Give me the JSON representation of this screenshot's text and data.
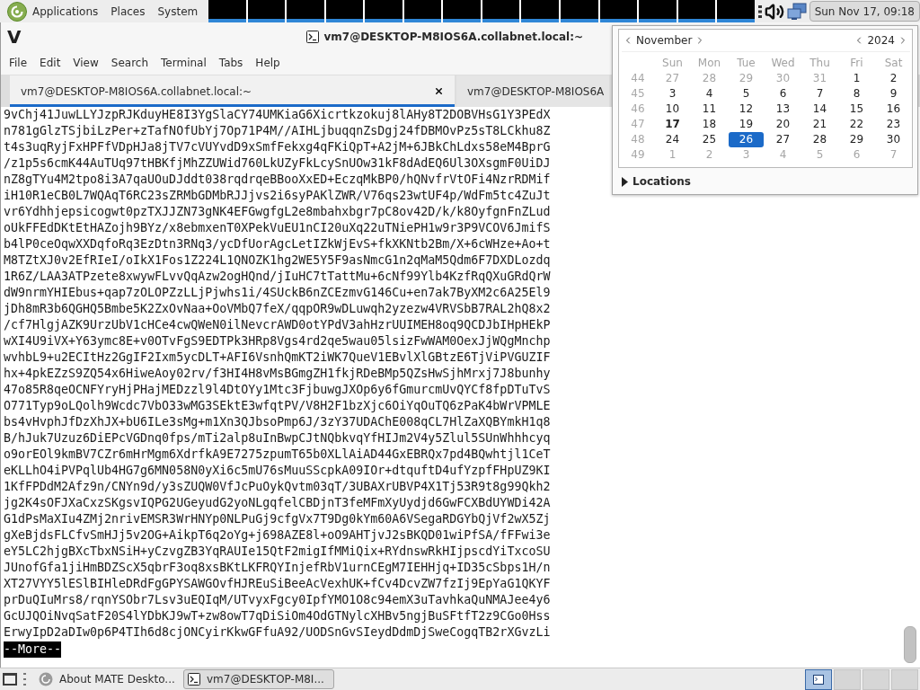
{
  "top_panel": {
    "menus": [
      "Applications",
      "Places",
      "System"
    ],
    "clock": {
      "label": "Sun Nov 17, 09:18",
      "active": true
    }
  },
  "window": {
    "logo": "V",
    "title": "vm7@DESKTOP-M8IOS6A.collabnet.local:~"
  },
  "menu_bar": [
    "File",
    "Edit",
    "View",
    "Search",
    "Terminal",
    "Tabs",
    "Help"
  ],
  "tabs": [
    {
      "label": "vm7@DESKTOP-M8IOS6A.collabnet.local:~",
      "selected": true
    },
    {
      "label": "vm7@DESKTOP-M8IOS6A",
      "selected": false
    }
  ],
  "terminal": {
    "lines": [
      "9vChj41JuwLLYJzpRJKduyHE8I3YgSlaCY74UMKiaG6Xicrtkzokuj8lAHy8T2DOBVHsG1Y3PEdX",
      "n781gGlzTSjbiLzPer+zTafNOfUbYj7Op71P4M//AIHLjbuqqnZsDgj24fDBMOvPz5sT8LCkhu8Z",
      "t4s3uqRyjFxHPFfVDpHJa8jTV7cVUYvdD9xSmfFekxg4qFKiQpT+A2jM+6JBkChLdxs58eM4BprG",
      "/z1p5s6cmK44AuTUq97tHBKfjMhZZUWid760LkUZyFkLcySnUOw31kF8dAdEQ6Ul3OXsgmF0UiDJ",
      "nZ8gTYu4M2tpo8i3A7qaUOuDJddt038rqdrqeBBooXxED+EczqMkBP0/hQNvfrVtOFi4NzrRDMif",
      "iH10R1eCB0L7WQAqT6RC23sZRMbGDMbRJJjvs2i6syPAKlZWR/V76qs23wtUF4p/WdFm5tc4ZuJt",
      "vr6Ydhhjepsicogwt0pzTXJJZN73gNK4EFGwgfgL2e8mbahxbgr7pC8ov42D/k/k8OyfgnFnZLud",
      "oUkFFEdDKtEtHAZojh9BYz/x8ebmxenT0XPekVuEU1nCI20uXq22uTNiePH1w9r3P9VCOV6JmifS",
      "b4lP0ceOqwXXDqfoRq3EzDtn3RNq3/ycDfUorAgcLetIZkWjEvS+fkXKNtb2Bm/X+6cWHze+Ao+t",
      "M8TZtXJ0v2EfRIeI/oIkX1Fos1Z224L1QNOZK1hg2WE5Y5F9asNmcG1n2qMaM5Qdm6F7DXDLozdq",
      "1R6Z/LAA3ATPzete8xwywFLvvQqAzw2ogHQnd/jIuHC7tTattMu+6cNf99Ylb4KzfRqQXuGRdQrW",
      "dW9nrmYHIEbus+qap7zOLOPZzLLjPjwhs1i/4SUckB6nZCEzmvG146Cu+en7ak7ByXM2c6A25El9",
      "jDh8mR3b6QGHQ5Bmbe5K2ZxOvNaa+OoVMbQ7feX/qqpOR9wDLuwqh2yzezw4VRVSbB7RAL2hQ8x2",
      "/cf7HlgjAZK9UrzUbV1cHCe4cwQWeN0ilNevcrAWD0otYPdV3ahHzrUUIMEH8oq9QCDJbIHpHEkP",
      "wXI4U9iVX+Y63ymc8E+v0OTvFgS9EDTPk3HRp8Vgs4rd2qe5wau05lsizFwWAM0OexJjWQgMnchp",
      "wvhbL9+u2ECItHz2GgIF2Ixm5ycDLT+AFI6VsnhQmKT2iWK7QueV1EBvlXlGBtzE6TjViPVGUZIF",
      "hx+4pkEZzS9ZQ54x6HiweAoy02rv/f3HI4H8vMsBGmgZH1fkjRDeBMp5QZsHwSjhMrxj7J8bunhy",
      "47o85R8qeOCNFYryHjPHajMEDzzl9l4DtOYy1Mtc3FjbuwgJXOp6y6fGmurcmUvQYCf8fpDTuTvS",
      "O771Typ9oLQolh9Wcdc7VbO33wMG3SEktE3wfqtPV/V8H2F1bzXjc6OiYqOuTQ6zPaK4bWrVPMLE",
      "bs4vHvphJfDzXhJX+bU6ILe3sMg+m1Xn3QJbsoPmp6J/3zY37UDAChE008qCL7HlZaXQBYmkH1q8",
      "B/hJuk7Uzuz6DiEPcVGDnq0fps/mTi2alp8uInBwpCJtNQbkvqYfHIJm2V4y5Zlul5SUnWhhhcyq",
      "o9orEOl9kmBV7CZr6mHrMgm6XdrfkA9E7275zpumT65b0XLlAiAD44GxEBRQx7pd4BQwhtjl1CeT",
      "eKLLhO4iPVPqlUb4HG7g6MN058N0yXi6c5mU76sMuuSScpkA09IOr+dtquftD4ufYzpfFHpUZ9KI",
      "1KfFPDdM2Afz9n/CNYn9d/y3sZUQW0VfJcPuOykQvtm03qT/3UBAXrUBVP4X1Tj53R9t8g99Qkh2",
      "jg2K4sOFJXaCxzSKgsvIQPG2UGeyudG2yoNLgqfelCBDjnT3feMFmXyUydjd6GwFCXBdUYWDi42A",
      "G1dPsMaXIu4ZMj2nrivEMSR3WrHNYp0NLPuGj9cfgVx7T9Dg0kYm60A6VSegaRDGYbQjVf2wX5Zj",
      "gXeBjdsFLCfvSmHJj5v2OG+AikpT6q2oYg+j698AZE8l+oO9AHTjvJ2sBKQD01wiPfSA/fFFwi3e",
      "eY5LC2hjgBXcTbxNSiH+yCzvgZB3YqRAUIe15QtF2migIfMMiQix+RYdnswRkHIjpscdYiTxcoSU",
      "JUnofGfa1jiHmBDZScX5qbrF3oq8xsBKtLKFRQYInjefRbV1urnCEgM7IEHHjq+ID35cSbps1H/n",
      "XT27VYY5lESlBIHleDRdFgGPYSAWGOvfHJREuSiBeeAcVexhUK+fCv4DcvZW7fzIj9EpYaG1QKYF",
      "prDuQIuMrs8/rqnYSObr7Lsv3uEQIqM/UTvyxFgcy0IpfYMO1O8c94emX3uTavhkaQuNMAJee4y6",
      "GcUJQOiNvqSatF20S4lYDbKJ9wT+zw8owT7qDiSiOm4OdGTNylcXHBv5ngjBuSFtfT2z9CGo0Hss",
      "ErwyIpD2aDIw0p6P4TIh6d8cjONCyirKkwGFfuA92/UODSnGvSIeydDdmDjSweCogqTB2rXGvzLi"
    ],
    "pager_prompt": "--More--"
  },
  "calendar": {
    "month": "November",
    "year": "2024",
    "weekdays": [
      "Sun",
      "Mon",
      "Tue",
      "Wed",
      "Thu",
      "Fri",
      "Sat"
    ],
    "weeks": [
      {
        "number": "44",
        "days": [
          {
            "label": "27",
            "outside": true,
            "today": false,
            "selected": false
          },
          {
            "label": "28",
            "outside": true,
            "today": false,
            "selected": false
          },
          {
            "label": "29",
            "outside": true,
            "today": false,
            "selected": false
          },
          {
            "label": "30",
            "outside": true,
            "today": false,
            "selected": false
          },
          {
            "label": "31",
            "outside": true,
            "today": false,
            "selected": false
          },
          {
            "label": "1",
            "outside": false,
            "today": false,
            "selected": false
          },
          {
            "label": "2",
            "outside": false,
            "today": false,
            "selected": false
          }
        ]
      },
      {
        "number": "45",
        "days": [
          {
            "label": "3",
            "outside": false,
            "today": false,
            "selected": false
          },
          {
            "label": "4",
            "outside": false,
            "today": false,
            "selected": false
          },
          {
            "label": "5",
            "outside": false,
            "today": false,
            "selected": false
          },
          {
            "label": "6",
            "outside": false,
            "today": false,
            "selected": false
          },
          {
            "label": "7",
            "outside": false,
            "today": false,
            "selected": false
          },
          {
            "label": "8",
            "outside": false,
            "today": false,
            "selected": false
          },
          {
            "label": "9",
            "outside": false,
            "today": false,
            "selected": false
          }
        ]
      },
      {
        "number": "46",
        "days": [
          {
            "label": "10",
            "outside": false,
            "today": false,
            "selected": false
          },
          {
            "label": "11",
            "outside": false,
            "today": false,
            "selected": false
          },
          {
            "label": "12",
            "outside": false,
            "today": false,
            "selected": false
          },
          {
            "label": "13",
            "outside": false,
            "today": false,
            "selected": false
          },
          {
            "label": "14",
            "outside": false,
            "today": false,
            "selected": false
          },
          {
            "label": "15",
            "outside": false,
            "today": false,
            "selected": false
          },
          {
            "label": "16",
            "outside": false,
            "today": false,
            "selected": false
          }
        ]
      },
      {
        "number": "47",
        "days": [
          {
            "label": "17",
            "outside": false,
            "today": true,
            "selected": false
          },
          {
            "label": "18",
            "outside": false,
            "today": false,
            "selected": false
          },
          {
            "label": "19",
            "outside": false,
            "today": false,
            "selected": false
          },
          {
            "label": "20",
            "outside": false,
            "today": false,
            "selected": false
          },
          {
            "label": "21",
            "outside": false,
            "today": false,
            "selected": false
          },
          {
            "label": "22",
            "outside": false,
            "today": false,
            "selected": false
          },
          {
            "label": "23",
            "outside": false,
            "today": false,
            "selected": false
          }
        ]
      },
      {
        "number": "48",
        "days": [
          {
            "label": "24",
            "outside": false,
            "today": false,
            "selected": false
          },
          {
            "label": "25",
            "outside": false,
            "today": false,
            "selected": false
          },
          {
            "label": "26",
            "outside": false,
            "today": false,
            "selected": true
          },
          {
            "label": "27",
            "outside": false,
            "today": false,
            "selected": false
          },
          {
            "label": "28",
            "outside": false,
            "today": false,
            "selected": false
          },
          {
            "label": "29",
            "outside": false,
            "today": false,
            "selected": false
          },
          {
            "label": "30",
            "outside": false,
            "today": false,
            "selected": false
          }
        ]
      },
      {
        "number": "49",
        "days": [
          {
            "label": "1",
            "outside": true,
            "today": false,
            "selected": false
          },
          {
            "label": "2",
            "outside": true,
            "today": false,
            "selected": false
          },
          {
            "label": "3",
            "outside": true,
            "today": false,
            "selected": false
          },
          {
            "label": "4",
            "outside": true,
            "today": false,
            "selected": false
          },
          {
            "label": "5",
            "outside": true,
            "today": false,
            "selected": false
          },
          {
            "label": "6",
            "outside": true,
            "today": false,
            "selected": false
          },
          {
            "label": "7",
            "outside": true,
            "today": false,
            "selected": false
          }
        ]
      }
    ]
  },
  "locations": {
    "label": "Locations",
    "expanded": false
  },
  "taskbar": {
    "windows": [
      {
        "kind": "about",
        "label": "About MATE Deskto...",
        "selected": false
      },
      {
        "kind": "terminal",
        "label": "vm7@DESKTOP-M8I...",
        "selected": true
      }
    ],
    "workspaces": [
      {
        "selected": true
      },
      {
        "selected": false
      },
      {
        "selected": false
      },
      {
        "selected": false
      }
    ]
  }
}
